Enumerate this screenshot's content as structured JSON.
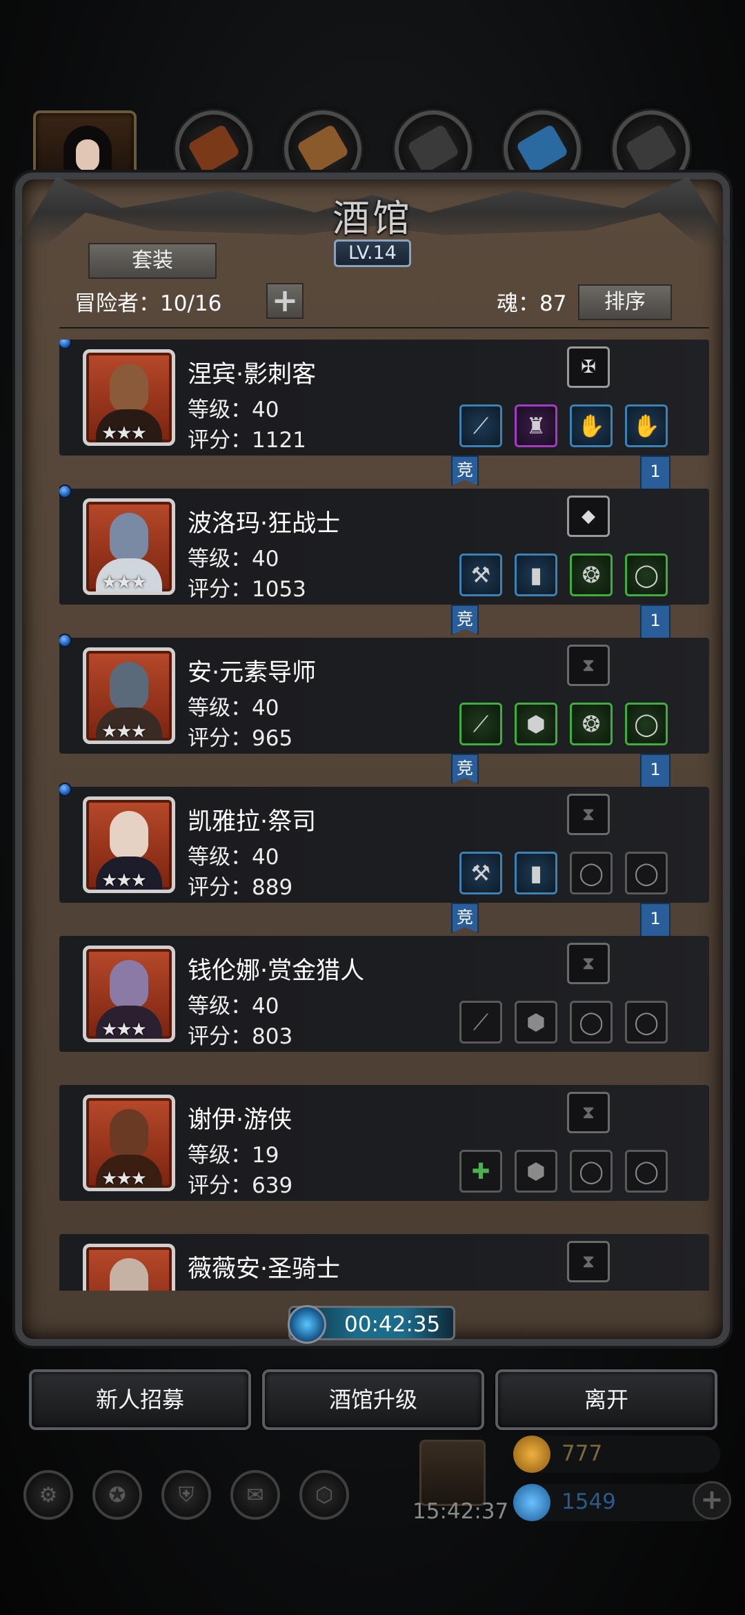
{
  "header": {
    "title": "酒馆",
    "level": "LV.14",
    "set_button": "套装",
    "adventurers_label": "冒险者：10/16",
    "add_label": "+",
    "soul_label": "魂：87",
    "sort_button": "排序"
  },
  "heroes": [
    {
      "name": "涅宾·影刺客",
      "level": "等级：40",
      "score": "评分：1121",
      "stars": "★★★",
      "tag_left": "竞",
      "tag_right": "1"
    },
    {
      "name": "波洛玛·狂战士",
      "level": "等级：40",
      "score": "评分：1053",
      "stars": "★★★",
      "tag_left": "竞",
      "tag_right": "1"
    },
    {
      "name": "安·元素导师",
      "level": "等级：40",
      "score": "评分：965",
      "stars": "★★★",
      "tag_left": "竞",
      "tag_right": "1"
    },
    {
      "name": "凯雅拉·祭司",
      "level": "等级：40",
      "score": "评分：889",
      "stars": "★★★",
      "tag_left": "竞",
      "tag_right": "1"
    },
    {
      "name": "钱伦娜·赏金猎人",
      "level": "等级：40",
      "score": "评分：803",
      "stars": "★★★"
    },
    {
      "name": "谢伊·游侠",
      "level": "等级：19",
      "score": "评分：639",
      "stars": "★★★"
    },
    {
      "name": "薇薇安·圣骑士",
      "stars": "★★★"
    }
  ],
  "timer": "00:42:35",
  "buttons": {
    "recruit": "新人招募",
    "upgrade": "酒馆升级",
    "leave": "离开"
  },
  "bottom": {
    "clock": "15:42:37",
    "gold": "777",
    "gems": "1549"
  },
  "colors": {
    "rarity_blue": "#3b82b6",
    "rarity_green": "#3fae3a",
    "rarity_purple": "#a33ac8",
    "tag_blue": "#2a5e9a"
  }
}
